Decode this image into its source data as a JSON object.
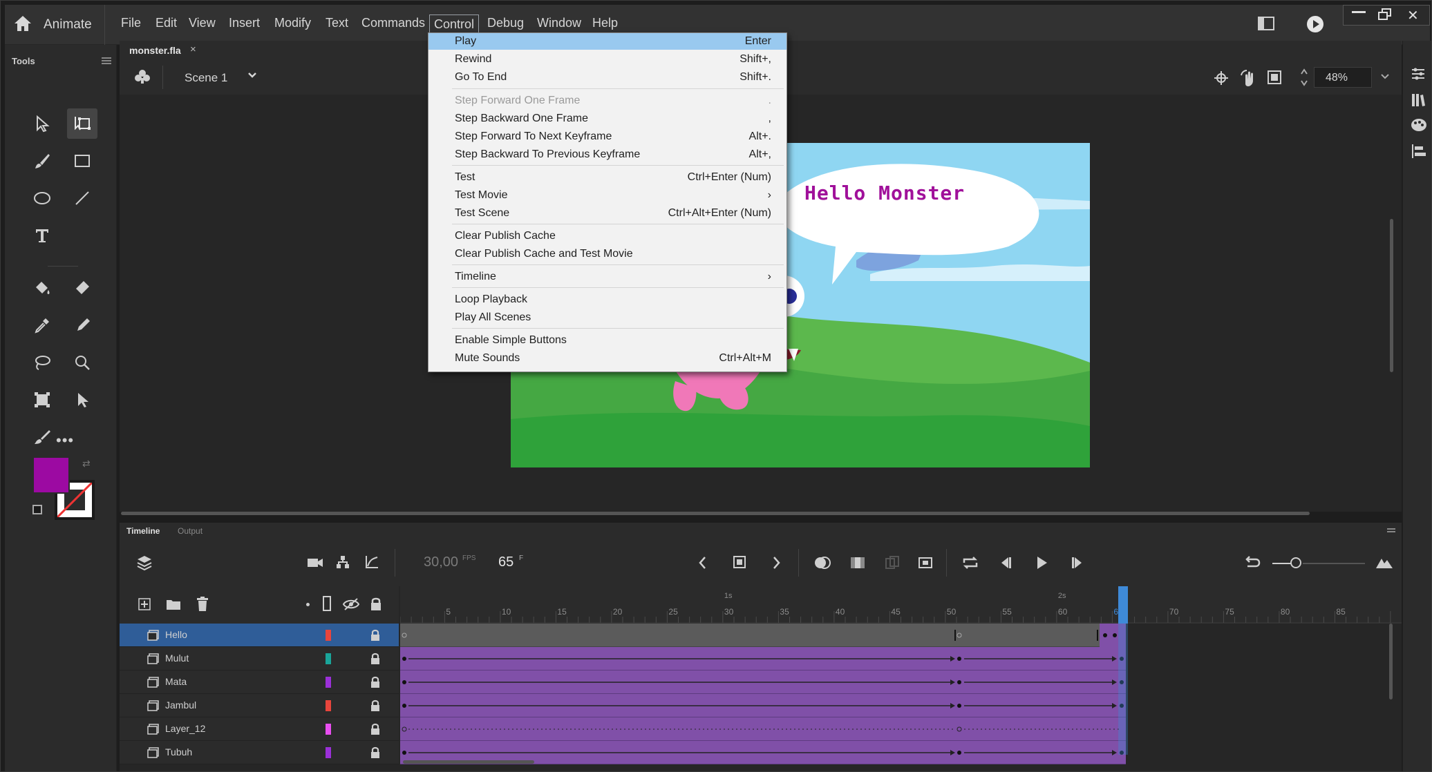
{
  "app": {
    "name": "Animate"
  },
  "menubar": [
    "File",
    "Edit",
    "View",
    "Insert",
    "Modify",
    "Text",
    "Commands",
    "Control",
    "Debug",
    "Window",
    "Help"
  ],
  "window_controls": [
    "minimize",
    "restore",
    "close"
  ],
  "tools_panel": {
    "title": "Tools"
  },
  "document": {
    "tab": "monster.fla",
    "scene": "Scene 1",
    "zoom": "48%"
  },
  "stage": {
    "speech_text": "Hello Monster"
  },
  "control_menu": {
    "items": [
      {
        "label": "Play",
        "shortcut": "Enter",
        "highlighted": true
      },
      {
        "label": "Rewind",
        "shortcut": "Shift+,"
      },
      {
        "label": "Go To End",
        "shortcut": "Shift+."
      },
      {
        "label": "Step Forward One Frame",
        "shortcut": ".",
        "disabled": true
      },
      {
        "label": "Step Backward One Frame",
        "shortcut": ","
      },
      {
        "label": "Step Forward To Next Keyframe",
        "shortcut": "Alt+."
      },
      {
        "label": "Step Backward To Previous Keyframe",
        "shortcut": "Alt+,"
      },
      {
        "label": "Test",
        "shortcut": "Ctrl+Enter (Num)"
      },
      {
        "label": "Test Movie",
        "shortcut": "›"
      },
      {
        "label": "Test Scene",
        "shortcut": "Ctrl+Alt+Enter (Num)"
      },
      {
        "label": "Clear Publish Cache",
        "shortcut": ""
      },
      {
        "label": "Clear Publish Cache and Test Movie",
        "shortcut": ""
      },
      {
        "label": "Timeline",
        "shortcut": "›"
      },
      {
        "label": "Loop Playback",
        "shortcut": ""
      },
      {
        "label": "Play All Scenes",
        "shortcut": ""
      },
      {
        "label": "Enable Simple Buttons",
        "shortcut": ""
      },
      {
        "label": "Mute Sounds",
        "shortcut": "Ctrl+Alt+M"
      }
    ]
  },
  "timeline": {
    "tabs": [
      "Timeline",
      "Output"
    ],
    "fps": "30,00",
    "fps_unit": "FPS",
    "frame": "65",
    "frame_unit": "F",
    "ruler_numbers": [
      "5",
      "10",
      "15",
      "20",
      "25",
      "30",
      "35",
      "40",
      "45",
      "50",
      "55",
      "60",
      "65",
      "70",
      "75",
      "80",
      "85"
    ],
    "ruler_seconds": [
      "1s",
      "2s"
    ],
    "layers": [
      {
        "name": "Hello",
        "color": "#e8453c",
        "selected": true
      },
      {
        "name": "Mulut",
        "color": "#1aa59a"
      },
      {
        "name": "Mata",
        "color": "#9b30d8"
      },
      {
        "name": "Jambul",
        "color": "#e8453c"
      },
      {
        "name": "Layer_12",
        "color": "#e84ef0"
      },
      {
        "name": "Tubuh",
        "color": "#9b30d8"
      }
    ]
  },
  "colors": {
    "stroke_swatch": "#ffffff",
    "fill_swatch": "#9c0aa2",
    "menu_highlight": "#99c9ef",
    "frame_span": "#8050a8",
    "selected_layer": "#2f5d98"
  }
}
